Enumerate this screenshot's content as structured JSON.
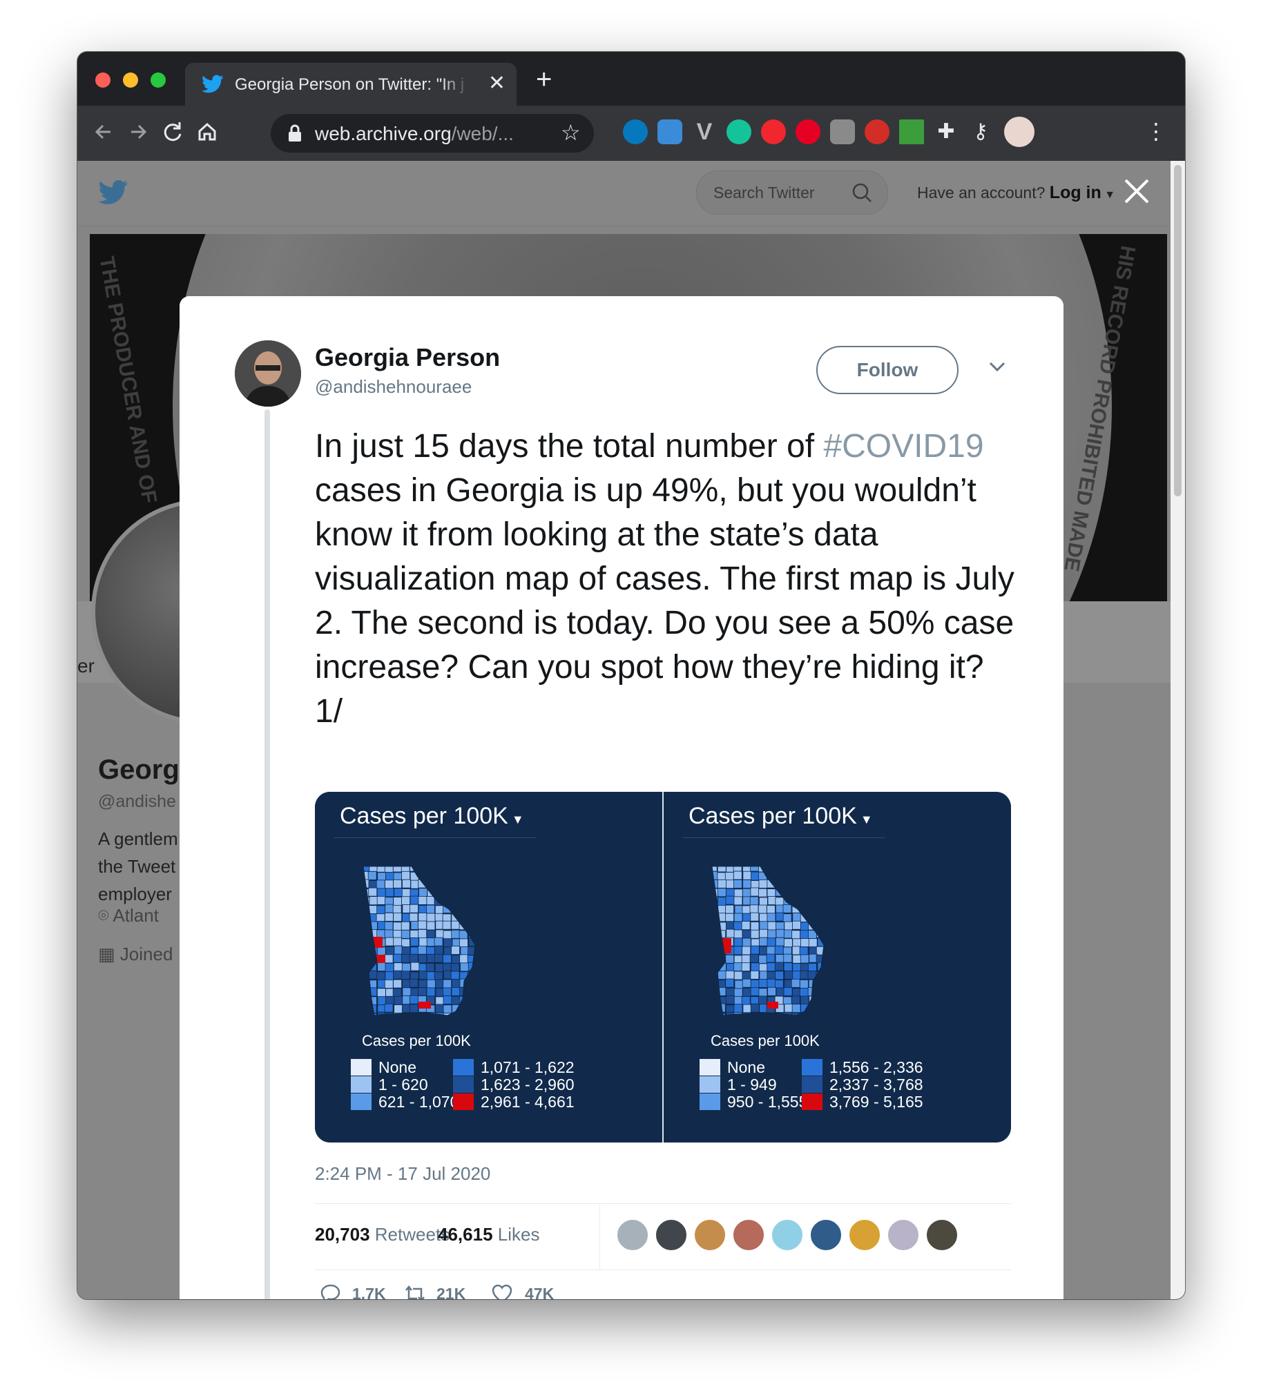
{
  "browser": {
    "tab_title": "Georgia Person on Twitter: \"In j",
    "tab_close": "✕",
    "new_tab": "+",
    "url_host": "web.archive.org",
    "url_path": "/web/...",
    "extensions": [
      "drupal-icon",
      "s-icon",
      "v-icon",
      "grammarly-icon",
      "adblock-icon",
      "pinterest-icon",
      "camera-icon",
      "lastpass-icon",
      "x-icon",
      "puzzle-icon",
      "key-icon"
    ]
  },
  "twitter_header": {
    "search_placeholder": "Search Twitter",
    "account_prompt": "Have an account?",
    "login_label": "Log in"
  },
  "background_profile": {
    "banner_text_left": "THE PRODUCER AND OF",
    "banner_text_right": "HIS RECORD PROHIBITED MADE",
    "side_text": "er",
    "name_partial": "Georg",
    "handle_partial": "@andishe",
    "bio_line1": "A gentlem",
    "bio_line2": "the Tweet",
    "bio_line3": "employer",
    "location_partial": "Atlant",
    "joined_partial": "Joined"
  },
  "tweet": {
    "author_name": "Georgia Person",
    "author_handle": "@andishehnouraee",
    "follow_label": "Follow",
    "text_before_hashtag": "In just 15 days the total number of ",
    "hashtag": "#COVID19",
    "text_after_hashtag": " cases in Georgia is up 49%, but you wouldn’t know it from looking at the state’s data visualization map of cases. The first map is July 2. The second is today. Do you see a 50% case increase? Can you spot how they’re hiding it? 1/",
    "timestamp": "2:24 PM - 17 Jul 2020",
    "retweets_count": "20,703",
    "retweets_label": "Retweets",
    "likes_count": "46,615",
    "likes_label": "Likes",
    "reply_count": "1.7K",
    "retweet_action_count": "21K",
    "like_action_count": "47K"
  },
  "maps": [
    {
      "title": "Cases per 100K",
      "legend_title": "Cases per 100K",
      "legend": [
        {
          "label": "None",
          "color": "#e6eefb"
        },
        {
          "label": "1 - 620",
          "color": "#9dc3f2"
        },
        {
          "label": "621 - 1,070",
          "color": "#5b9ae8"
        },
        {
          "label": "1,071 - 1,622",
          "color": "#2a74d9"
        },
        {
          "label": "1,623 - 2,960",
          "color": "#1f4f96"
        },
        {
          "label": "2,961 - 4,661",
          "color": "#d9080f"
        }
      ]
    },
    {
      "title": "Cases per 100K",
      "legend_title": "Cases per 100K",
      "legend": [
        {
          "label": "None",
          "color": "#e6eefb"
        },
        {
          "label": "1 - 949",
          "color": "#9dc3f2"
        },
        {
          "label": "950 - 1,555",
          "color": "#5b9ae8"
        },
        {
          "label": "1,556 - 2,336",
          "color": "#2a74d9"
        },
        {
          "label": "2,337 - 3,768",
          "color": "#1f4f96"
        },
        {
          "label": "3,769 - 5,165",
          "color": "#d9080f"
        }
      ]
    }
  ],
  "colors": {
    "twitter_blue": "#1da1f2",
    "hashtag_gray": "#8899a6",
    "map_background": "#112a4b"
  }
}
